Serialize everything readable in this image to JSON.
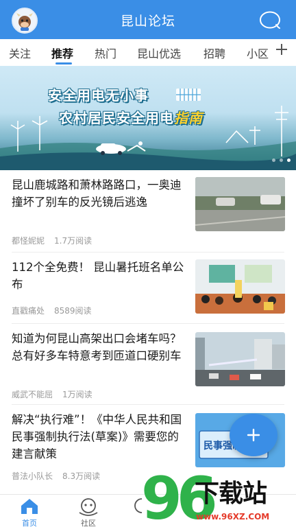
{
  "header": {
    "title": "昆山论坛",
    "avatar_icon": "cow-mascot-icon",
    "search_icon": "search-icon",
    "color": "#3a8ee6"
  },
  "tabs": [
    {
      "label": "关注"
    },
    {
      "label": "推荐",
      "active": true
    },
    {
      "label": "热门"
    },
    {
      "label": "昆山优选"
    },
    {
      "label": "招聘"
    },
    {
      "label": "小区"
    }
  ],
  "banner": {
    "line1": "安全用电无小事",
    "line2_main": "农村居民安全用电",
    "line2_highlight": "指南",
    "slide_count": 3,
    "active_slide": 3
  },
  "news": [
    {
      "title": "昆山鹿城路和萧林路路口，一奥迪撞坏了别车的反光镜后逃逸",
      "author": "都怪妮妮",
      "views": "1.7万阅读"
    },
    {
      "title": "112个全免费！ 昆山暑托班名单公布",
      "author": "直戳痛处",
      "views": "8589阅读"
    },
    {
      "title": "知道为何昆山高架出口会堵车吗？总有好多车特意考到匝道口硬别车",
      "author": "威武不能屈",
      "views": "1万阅读"
    },
    {
      "title": "解决“执行难”！《中华人民共和国民事强制执行法(草案)》需要您的建言献策",
      "author": "普法小队长",
      "views": "8.3万阅读"
    }
  ],
  "thumb4_text": "民事强制",
  "bottom_nav": [
    {
      "label": "首页",
      "icon": "home-icon",
      "active": true
    },
    {
      "label": "社区",
      "icon": "community-icon"
    },
    {
      "label": "",
      "icon": "discover-icon"
    }
  ],
  "watermark": {
    "brand": "下载站",
    "url": "www.96XZ.COM"
  }
}
